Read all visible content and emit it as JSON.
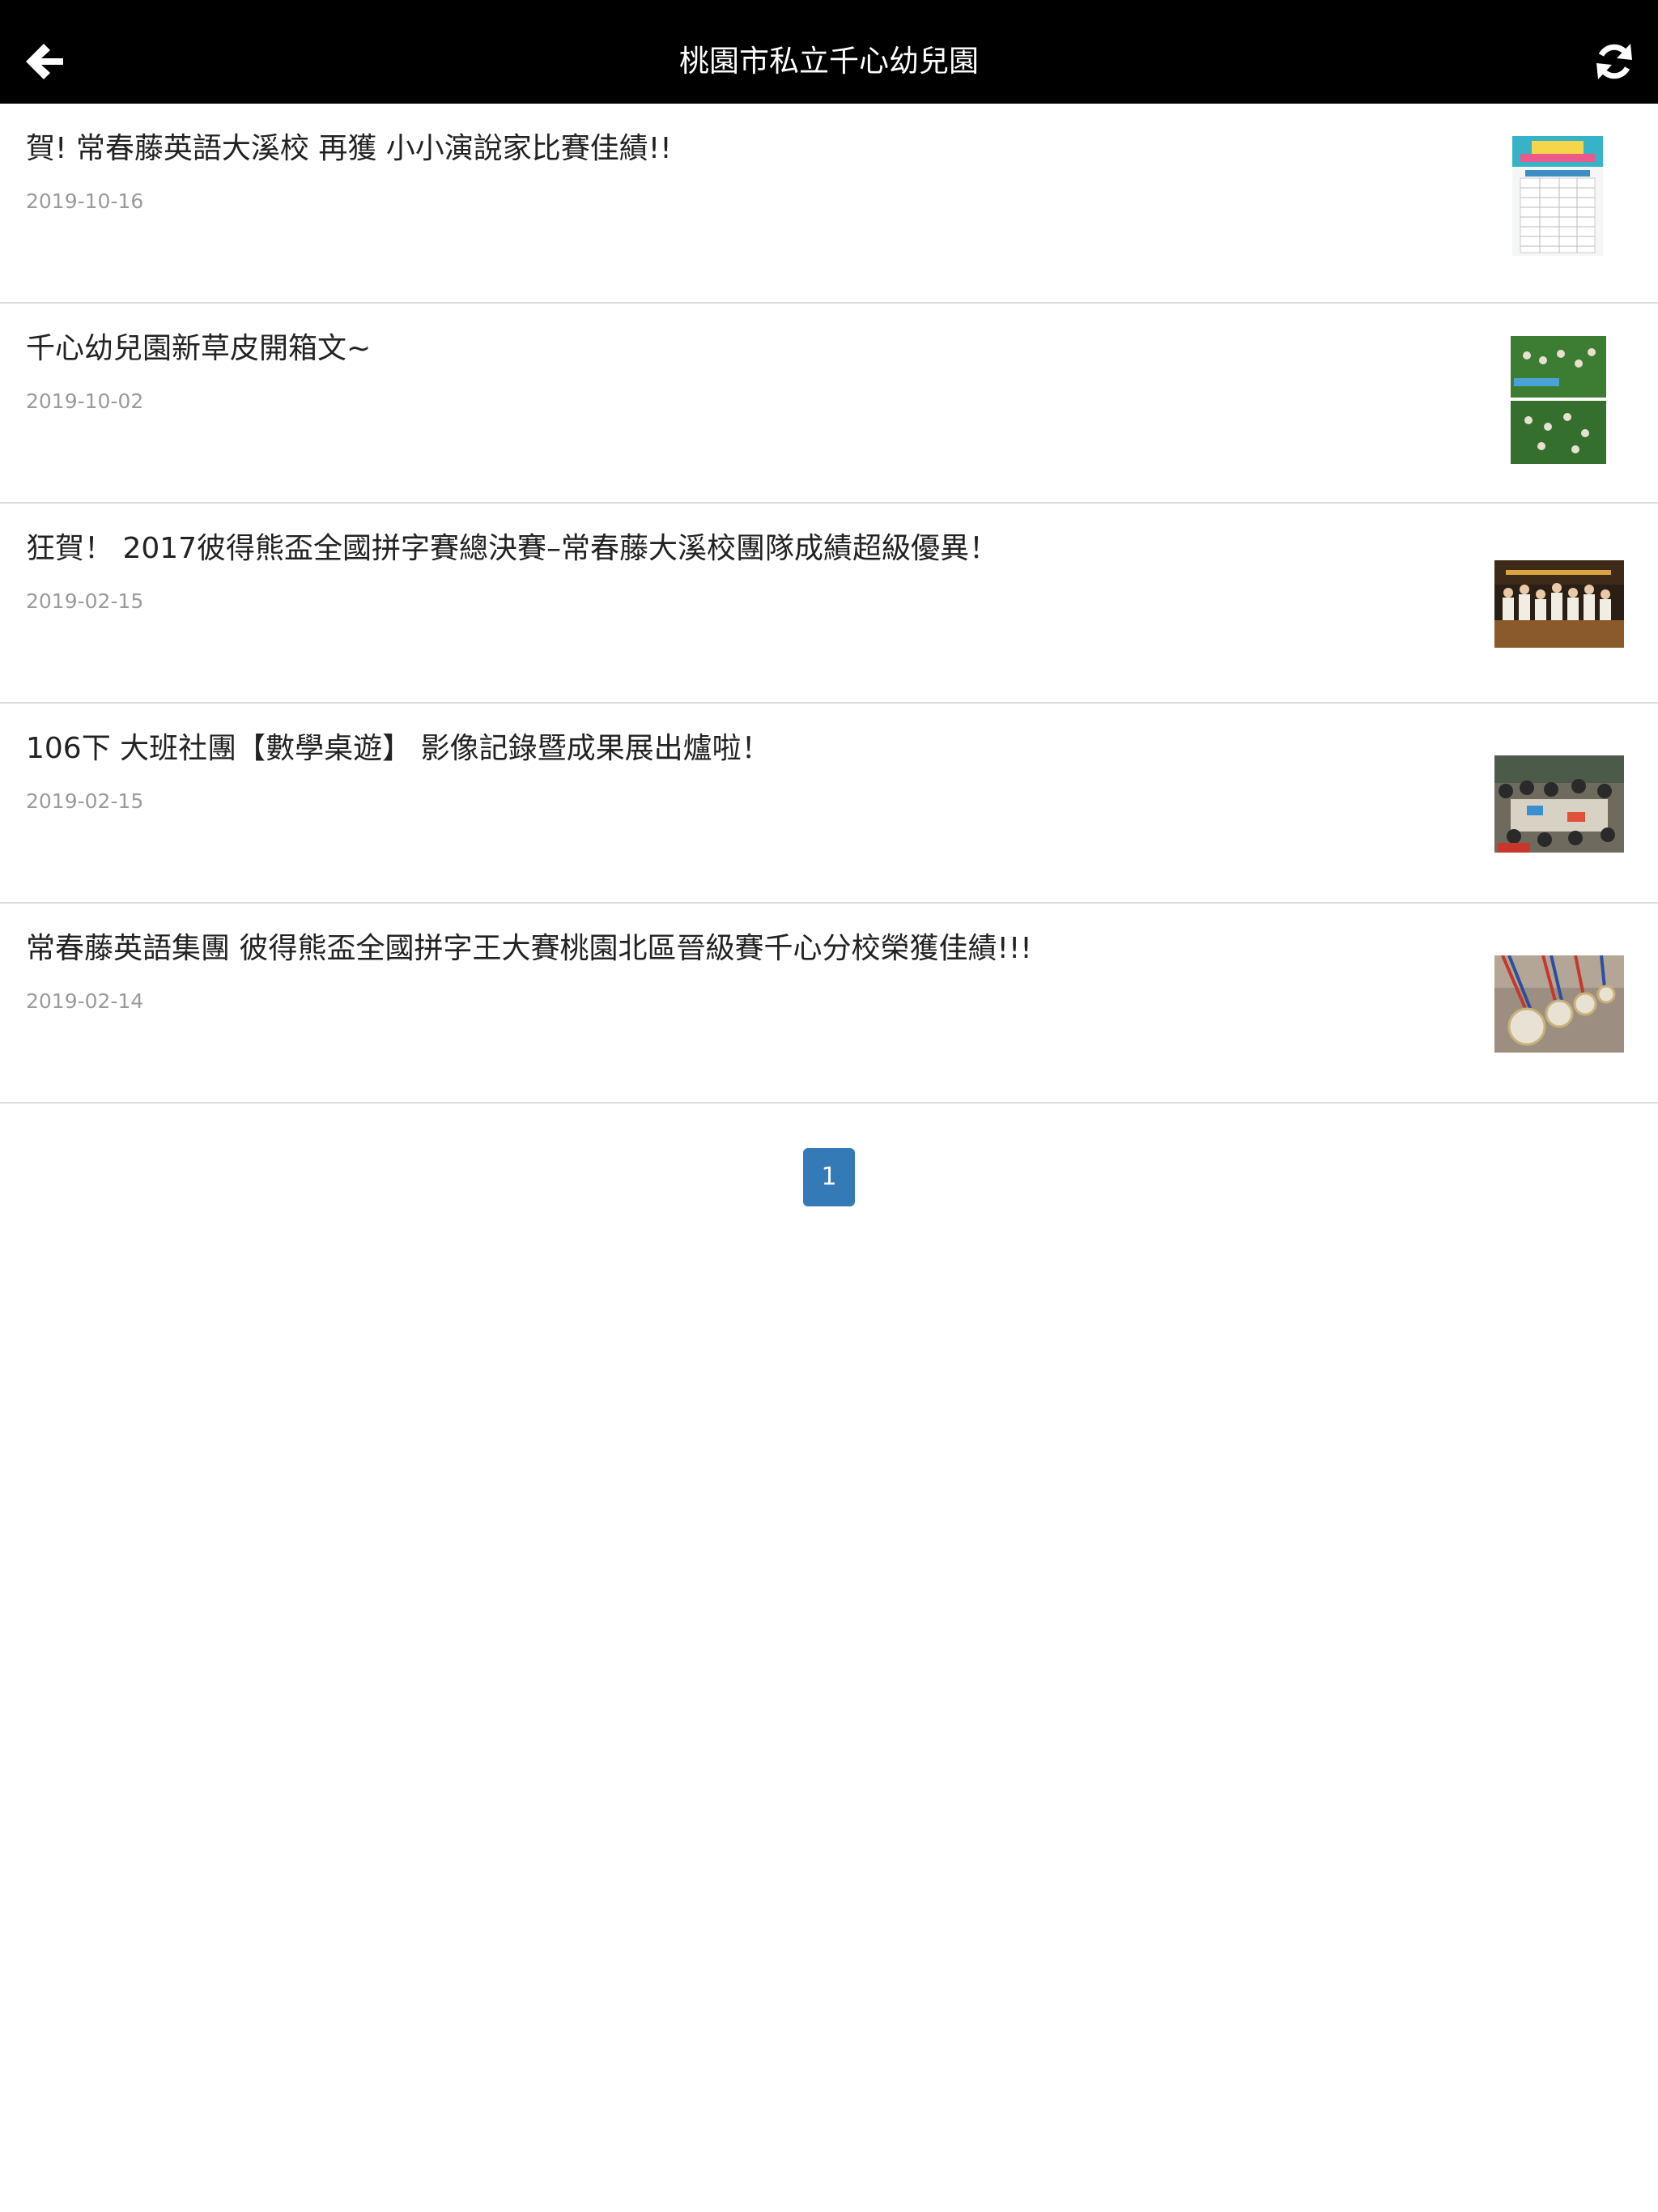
{
  "header": {
    "title": "桃園市私立千心幼兒園",
    "back_icon": "arrow-left-icon",
    "refresh_icon": "refresh-icon"
  },
  "articles": [
    {
      "title": "賀! 常春藤英語大溪校 再獲 小小演說家比賽佳績!!",
      "date": "2019-10-16"
    },
    {
      "title": "千心幼兒園新草皮開箱文~",
      "date": "2019-10-02"
    },
    {
      "title": "狂賀！ 2017彼得熊盃全國拼字賽總決賽–常春藤大溪校團隊成績超級優異！",
      "date": "2019-02-15"
    },
    {
      "title": "106下 大班社團【數學桌遊】 影像記錄暨成果展出爐啦！",
      "date": "2019-02-15"
    },
    {
      "title": "常春藤英語集團 彼得熊盃全國拼字王大賽桃園北區晉級賽千心分校榮獲佳績!!!",
      "date": "2019-02-14"
    }
  ],
  "pagination": {
    "current": "1"
  },
  "colors": {
    "header_bg": "#000000",
    "accent": "#337ab7",
    "divider": "#dddddd",
    "date_text": "#9a9a9a"
  }
}
